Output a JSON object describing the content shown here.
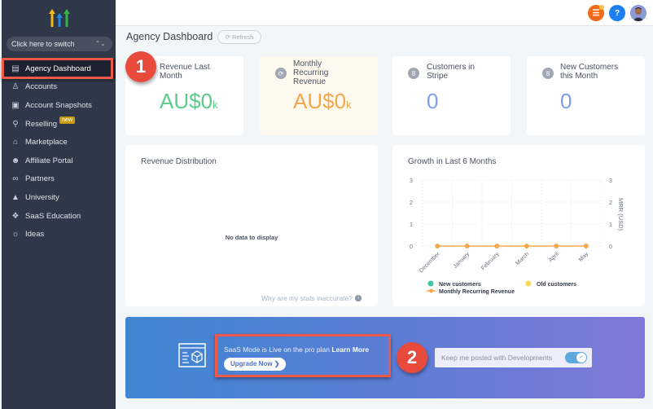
{
  "sidebar": {
    "switcher_label": "Click here to switch",
    "items": [
      {
        "label": "Agency Dashboard",
        "icon": "dashboard-icon",
        "active": true
      },
      {
        "label": "Accounts",
        "icon": "user-icon"
      },
      {
        "label": "Account Snapshots",
        "icon": "snapshot-icon"
      },
      {
        "label": "Reselling",
        "icon": "reselling-icon",
        "badge": "new"
      },
      {
        "label": "Marketplace",
        "icon": "bag-icon"
      },
      {
        "label": "Affiliate Portal",
        "icon": "users-icon"
      },
      {
        "label": "Partners",
        "icon": "handshake-icon"
      },
      {
        "label": "University",
        "icon": "graduation-cap-icon"
      },
      {
        "label": "SaaS Education",
        "icon": "cubes-icon"
      },
      {
        "label": "Ideas",
        "icon": "lightbulb-icon"
      }
    ]
  },
  "topbar": {
    "help_label": "?"
  },
  "page": {
    "title": "Agency Dashboard",
    "refresh_label": "Refresh"
  },
  "annotations": {
    "marker1": "1",
    "marker2": "2"
  },
  "stats": [
    {
      "label": "Revenue Last Month",
      "value": "AU$0",
      "unit": "k",
      "color": "#5ccb8a"
    },
    {
      "label": "Monthly Recurring Revenue",
      "value": "AU$0",
      "unit": "k",
      "color": "#f3a74c"
    },
    {
      "label": "Customers in Stripe",
      "value": "0",
      "color": "#7f9cf0"
    },
    {
      "label": "New Customers this Month",
      "value": "0",
      "color": "#7f9cf0"
    }
  ],
  "revenue_distribution": {
    "title": "Revenue Distribution",
    "empty_text": "No data to display",
    "help_link": "Why are my stats inaccurate?"
  },
  "chart_data": {
    "type": "line",
    "title": "Growth in Last 6 Months",
    "categories": [
      "December",
      "January",
      "February",
      "March",
      "April",
      "May"
    ],
    "series": [
      {
        "name": "New customers",
        "values": [
          0,
          0,
          0,
          0,
          0,
          0
        ],
        "color": "#3fc6a6",
        "kind": "bar"
      },
      {
        "name": "Old customers",
        "values": [
          0,
          0,
          0,
          0,
          0,
          0
        ],
        "color": "#f7d95a",
        "kind": "bar"
      },
      {
        "name": "Monthly Recurring Revenue",
        "values": [
          0,
          0,
          0,
          0,
          0,
          0
        ],
        "color": "#f6a94c",
        "kind": "line"
      }
    ],
    "ylim": [
      0,
      3
    ],
    "yticks": [
      0,
      1,
      2,
      3
    ],
    "y2label": "MRR (USD)",
    "y2ticks": [
      0,
      1,
      2,
      3
    ],
    "grid": true,
    "legend": "bottom"
  },
  "banner": {
    "text": "SaaS Mode is Live on the pro plan",
    "learn_more": "Learn More",
    "upgrade_label": "Upgrade Now ❯",
    "keep_posted_label": "Keep me posted with Developments",
    "keep_posted_on": true
  }
}
